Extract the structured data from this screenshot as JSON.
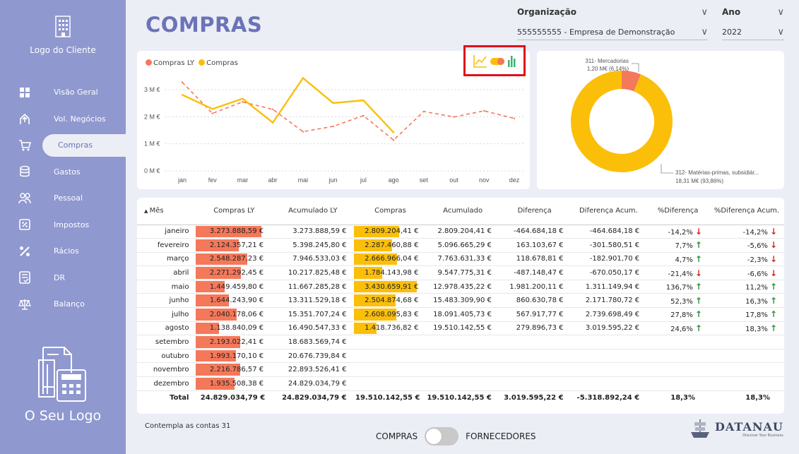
{
  "sidebar": {
    "client_logo": "Logo do Cliente",
    "your_logo": "O Seu Logo",
    "items": [
      {
        "label": "Visão Geral",
        "icon": "overview-icon"
      },
      {
        "label": "Vol. Negócios",
        "icon": "business-volume-icon"
      },
      {
        "label": "Compras",
        "icon": "cart-icon"
      },
      {
        "label": "Gastos",
        "icon": "coins-icon"
      },
      {
        "label": "Pessoal",
        "icon": "people-icon"
      },
      {
        "label": "Impostos",
        "icon": "tax-icon"
      },
      {
        "label": "Rácios",
        "icon": "percent-icon"
      },
      {
        "label": "DR",
        "icon": "report-icon"
      },
      {
        "label": "Balanço",
        "icon": "balance-icon"
      }
    ]
  },
  "title": "COMPRAS",
  "filters": {
    "org_label": "Organização",
    "org_value": "555555555 - Empresa de Demonstração",
    "year_label": "Ano",
    "year_value": "2022"
  },
  "line_chart": {
    "legend": [
      "Compras LY",
      "Compras"
    ]
  },
  "chart_data": [
    {
      "type": "line",
      "x": [
        "jan",
        "fev",
        "mar",
        "abr",
        "mai",
        "jun",
        "jul",
        "ago",
        "set",
        "out",
        "nov",
        "dez"
      ],
      "yticks": [
        "0 M €",
        "1 M €",
        "2 M €",
        "3 M €"
      ],
      "ylim": [
        0,
        3.6
      ],
      "series": [
        {
          "name": "Compras LY",
          "color": "#f4785a",
          "dashed": true,
          "values": [
            3.274,
            2.124,
            2.548,
            2.271,
            1.449,
            1.644,
            2.04,
            1.139,
            2.193,
            1.993,
            2.217,
            1.936
          ]
        },
        {
          "name": "Compras",
          "color": "#fbbf0a",
          "dashed": false,
          "values": [
            2.809,
            2.287,
            2.667,
            1.784,
            3.431,
            2.505,
            2.608,
            1.419
          ]
        }
      ]
    },
    {
      "type": "pie",
      "slices": [
        {
          "label": "311- Mercadorias",
          "detail": "1,20 M€ (6,14%)",
          "value": 6.14,
          "color": "#f4785a"
        },
        {
          "label": "312- Matérias-primas, subsidiár...",
          "detail": "18,31 M€ (93,86%)",
          "value": 93.86,
          "color": "#fbbf0a"
        }
      ]
    }
  ],
  "table": {
    "headers": [
      "Mês",
      "Compras LY",
      "Acumulado LY",
      "Compras",
      "Acumulado",
      "Diferença",
      "Diferença Acum.",
      "%Diferença",
      "%Diferença Acum."
    ],
    "rows": [
      {
        "m": "janeiro",
        "ly": "3.273.888,59 €",
        "lyp": 100,
        "aly": "3.273.888,59 €",
        "c": "2.809.204,41 €",
        "cp": 72,
        "ac": "2.809.204,41 €",
        "d": "-464.684,18 €",
        "da": "-464.684,18 €",
        "pd": "-14,2%",
        "pdu": false,
        "pda": "-14,2%",
        "pdau": false
      },
      {
        "m": "fevereiro",
        "ly": "2.124.357,21 €",
        "lyp": 65,
        "aly": "5.398.245,80 €",
        "c": "2.287.460,88 €",
        "cp": 61,
        "ac": "5.096.665,29 €",
        "d": "163.103,67 €",
        "da": "-301.580,51 €",
        "pd": "7,7%",
        "pdu": true,
        "pda": "-5,6%",
        "pdau": false
      },
      {
        "m": "março",
        "ly": "2.548.287,23 €",
        "lyp": 78,
        "aly": "7.946.533,03 €",
        "c": "2.666.966,04 €",
        "cp": 69,
        "ac": "7.763.631,33 €",
        "d": "118.678,81 €",
        "da": "-182.901,70 €",
        "pd": "4,7%",
        "pdu": true,
        "pda": "-2,3%",
        "pdau": false
      },
      {
        "m": "abril",
        "ly": "2.271.292,45 €",
        "lyp": 69,
        "aly": "10.217.825,48 €",
        "c": "1.784.143,98 €",
        "cp": 45,
        "ac": "9.547.775,31 €",
        "d": "-487.148,47 €",
        "da": "-670.050,17 €",
        "pd": "-21,4%",
        "pdu": false,
        "pda": "-6,6%",
        "pdau": false
      },
      {
        "m": "maio",
        "ly": "1.449.459,80 €",
        "lyp": 44,
        "aly": "11.667.285,28 €",
        "c": "3.430.659,91 €",
        "cp": 100,
        "ac": "12.978.435,22 €",
        "d": "1.981.200,11 €",
        "da": "1.311.149,94 €",
        "pd": "136,7%",
        "pdu": true,
        "pda": "11,2%",
        "pdau": true
      },
      {
        "m": "junho",
        "ly": "1.644.243,90 €",
        "lyp": 50,
        "aly": "13.311.529,18 €",
        "c": "2.504.874,68 €",
        "cp": 66,
        "ac": "15.483.309,90 €",
        "d": "860.630,78 €",
        "da": "2.171.780,72 €",
        "pd": "52,3%",
        "pdu": true,
        "pda": "16,3%",
        "pdau": true
      },
      {
        "m": "julho",
        "ly": "2.040.178,06 €",
        "lyp": 62,
        "aly": "15.351.707,24 €",
        "c": "2.608.095,83 €",
        "cp": 68,
        "ac": "18.091.405,73 €",
        "d": "567.917,77 €",
        "da": "2.739.698,49 €",
        "pd": "27,8%",
        "pdu": true,
        "pda": "17,8%",
        "pdau": true
      },
      {
        "m": "agosto",
        "ly": "1.138.840,09 €",
        "lyp": 35,
        "aly": "16.490.547,33 €",
        "c": "1.418.736,82 €",
        "cp": 36,
        "ac": "19.510.142,55 €",
        "d": "279.896,73 €",
        "da": "3.019.595,22 €",
        "pd": "24,6%",
        "pdu": true,
        "pda": "18,3%",
        "pdau": true
      },
      {
        "m": "setembro",
        "ly": "2.193.022,41 €",
        "lyp": 67,
        "aly": "18.683.569,74 €"
      },
      {
        "m": "outubro",
        "ly": "1.993.170,10 €",
        "lyp": 61,
        "aly": "20.676.739,84 €"
      },
      {
        "m": "novembro",
        "ly": "2.216.786,57 €",
        "lyp": 68,
        "aly": "22.893.526,41 €"
      },
      {
        "m": "dezembro",
        "ly": "1.935.508,38 €",
        "lyp": 59,
        "aly": "24.829.034,79 €"
      }
    ],
    "total": {
      "m": "Total",
      "ly": "24.829.034,79 €",
      "aly": "24.829.034,79 €",
      "c": "19.510.142,55 €",
      "ac": "19.510.142,55 €",
      "d": "3.019.595,22 €",
      "da": "-5.318.892,24 €",
      "pd": "18,3%",
      "pda": "18,3%"
    }
  },
  "footnote": "Contempla as contas 31",
  "toggle": {
    "left": "COMPRAS",
    "right": "FORNECEDORES"
  },
  "brand": {
    "name": "DATANAU",
    "tagline": "Discover Your Business"
  },
  "colors": {
    "sidebar": "#8f98cf",
    "accent": "#6b73b8",
    "ly": "#f4785a",
    "current": "#fbbf0a",
    "up": "#2f8f3e",
    "down": "#d0281a"
  }
}
